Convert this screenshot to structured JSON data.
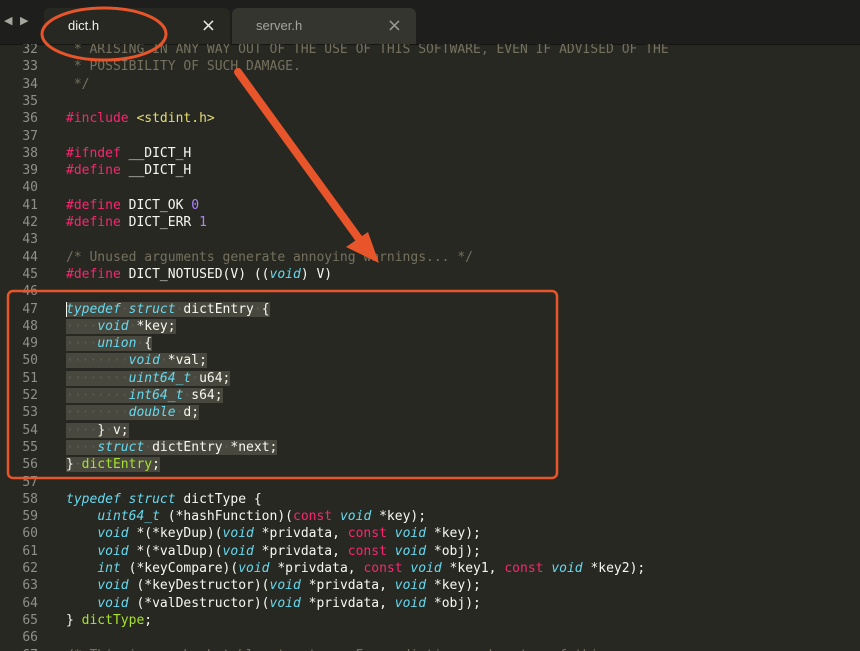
{
  "tabs": [
    {
      "label": "dict.h",
      "active": true
    },
    {
      "label": "server.h",
      "active": false
    }
  ],
  "tab_close_glyph": "×",
  "nav_arrows": "◀ ▶",
  "colors": {
    "comment": "#75715e",
    "keyword": "#f92672",
    "storage": "#66d9ef",
    "string": "#e6db74",
    "number": "#ae81ff",
    "entity": "#a6e22e",
    "annotation": "#e8552a",
    "selection": "#49483e"
  },
  "annotations": {
    "circle_target": "dict.h tab",
    "arrow_target": "dictEntry struct",
    "box_target": "lines 47-56"
  },
  "lines": [
    {
      "n": "32",
      "tokens": [
        [
          "comment",
          " * ARISING IN ANY WAY OUT OF THE USE OF THIS SOFTWARE, EVEN IF ADVISED OF THE"
        ]
      ]
    },
    {
      "n": "33",
      "tokens": [
        [
          "comment",
          " * POSSIBILITY OF SUCH DAMAGE."
        ]
      ]
    },
    {
      "n": "34",
      "tokens": [
        [
          "comment",
          " */"
        ]
      ]
    },
    {
      "n": "35",
      "tokens": []
    },
    {
      "n": "36",
      "tokens": [
        [
          "keyword",
          "#include"
        ],
        [
          "plain",
          " "
        ],
        [
          "string",
          "<stdint.h>"
        ]
      ]
    },
    {
      "n": "37",
      "tokens": []
    },
    {
      "n": "38",
      "tokens": [
        [
          "keyword",
          "#ifndef"
        ],
        [
          "plain",
          " __DICT_H"
        ]
      ]
    },
    {
      "n": "39",
      "tokens": [
        [
          "keyword",
          "#define"
        ],
        [
          "plain",
          " __DICT_H"
        ]
      ]
    },
    {
      "n": "40",
      "tokens": []
    },
    {
      "n": "41",
      "tokens": [
        [
          "keyword",
          "#define"
        ],
        [
          "plain",
          " DICT_OK "
        ],
        [
          "number",
          "0"
        ]
      ]
    },
    {
      "n": "42",
      "tokens": [
        [
          "keyword",
          "#define"
        ],
        [
          "plain",
          " DICT_ERR "
        ],
        [
          "number",
          "1"
        ]
      ]
    },
    {
      "n": "43",
      "tokens": []
    },
    {
      "n": "44",
      "tokens": [
        [
          "comment",
          "/* Unused arguments generate annoying warnings... */"
        ]
      ]
    },
    {
      "n": "45",
      "tokens": [
        [
          "keyword",
          "#define"
        ],
        [
          "plain",
          " DICT_NOTUSED(V) (("
        ],
        [
          "storage",
          "void"
        ],
        [
          "plain",
          ") V)"
        ]
      ]
    },
    {
      "n": "46",
      "tokens": []
    },
    {
      "n": "47",
      "caret": true,
      "tokens": [
        [
          "storage",
          "typedef"
        ],
        [
          "ws",
          "·"
        ],
        [
          "storage",
          "struct"
        ],
        [
          "ws",
          "·"
        ],
        [
          "plain",
          "dictEntry"
        ],
        [
          "ws",
          "·"
        ],
        [
          "plain",
          "{"
        ]
      ],
      "selected": true
    },
    {
      "n": "48",
      "tokens": [
        [
          "ws",
          "····"
        ],
        [
          "storage",
          "void"
        ],
        [
          "ws",
          "·"
        ],
        [
          "plain",
          "*key;"
        ]
      ],
      "selected": true
    },
    {
      "n": "49",
      "tokens": [
        [
          "ws",
          "····"
        ],
        [
          "storage",
          "union"
        ],
        [
          "ws",
          "·"
        ],
        [
          "plain",
          "{"
        ]
      ],
      "selected": true
    },
    {
      "n": "50",
      "tokens": [
        [
          "ws",
          "········"
        ],
        [
          "storage",
          "void"
        ],
        [
          "ws",
          "·"
        ],
        [
          "plain",
          "*val;"
        ]
      ],
      "selected": true
    },
    {
      "n": "51",
      "tokens": [
        [
          "ws",
          "········"
        ],
        [
          "storage",
          "uint64_t"
        ],
        [
          "ws",
          "·"
        ],
        [
          "plain",
          "u64;"
        ]
      ],
      "selected": true
    },
    {
      "n": "52",
      "tokens": [
        [
          "ws",
          "········"
        ],
        [
          "storage",
          "int64_t"
        ],
        [
          "ws",
          "·"
        ],
        [
          "plain",
          "s64;"
        ]
      ],
      "selected": true
    },
    {
      "n": "53",
      "tokens": [
        [
          "ws",
          "········"
        ],
        [
          "storage",
          "double"
        ],
        [
          "ws",
          "·"
        ],
        [
          "plain",
          "d;"
        ]
      ],
      "selected": true
    },
    {
      "n": "54",
      "tokens": [
        [
          "ws",
          "····"
        ],
        [
          "plain",
          "}"
        ],
        [
          "ws",
          "·"
        ],
        [
          "plain",
          "v;"
        ]
      ],
      "selected": true
    },
    {
      "n": "55",
      "tokens": [
        [
          "ws",
          "····"
        ],
        [
          "storage",
          "struct"
        ],
        [
          "ws",
          "·"
        ],
        [
          "plain",
          "dictEntry"
        ],
        [
          "ws",
          "·"
        ],
        [
          "plain",
          "*next;"
        ]
      ],
      "selected": true
    },
    {
      "n": "56",
      "tokens": [
        [
          "plain",
          "}"
        ],
        [
          "ws",
          "·"
        ],
        [
          "entity",
          "dictEntry"
        ],
        [
          "plain",
          ";"
        ]
      ],
      "selected": true
    },
    {
      "n": "57",
      "tokens": []
    },
    {
      "n": "58",
      "tokens": [
        [
          "storage",
          "typedef"
        ],
        [
          "plain",
          " "
        ],
        [
          "storage",
          "struct"
        ],
        [
          "plain",
          " dictType {"
        ]
      ]
    },
    {
      "n": "59",
      "tokens": [
        [
          "plain",
          "    "
        ],
        [
          "storage",
          "uint64_t"
        ],
        [
          "plain",
          " (*hashFunction)("
        ],
        [
          "keyword",
          "const"
        ],
        [
          "plain",
          " "
        ],
        [
          "storage",
          "void"
        ],
        [
          "plain",
          " *key);"
        ]
      ]
    },
    {
      "n": "60",
      "tokens": [
        [
          "plain",
          "    "
        ],
        [
          "storage",
          "void"
        ],
        [
          "plain",
          " *(*keyDup)("
        ],
        [
          "storage",
          "void"
        ],
        [
          "plain",
          " *privdata, "
        ],
        [
          "keyword",
          "const"
        ],
        [
          "plain",
          " "
        ],
        [
          "storage",
          "void"
        ],
        [
          "plain",
          " *key);"
        ]
      ]
    },
    {
      "n": "61",
      "tokens": [
        [
          "plain",
          "    "
        ],
        [
          "storage",
          "void"
        ],
        [
          "plain",
          " *(*valDup)("
        ],
        [
          "storage",
          "void"
        ],
        [
          "plain",
          " *privdata, "
        ],
        [
          "keyword",
          "const"
        ],
        [
          "plain",
          " "
        ],
        [
          "storage",
          "void"
        ],
        [
          "plain",
          " *obj);"
        ]
      ]
    },
    {
      "n": "62",
      "tokens": [
        [
          "plain",
          "    "
        ],
        [
          "storage",
          "int"
        ],
        [
          "plain",
          " (*keyCompare)("
        ],
        [
          "storage",
          "void"
        ],
        [
          "plain",
          " *privdata, "
        ],
        [
          "keyword",
          "const"
        ],
        [
          "plain",
          " "
        ],
        [
          "storage",
          "void"
        ],
        [
          "plain",
          " *key1, "
        ],
        [
          "keyword",
          "const"
        ],
        [
          "plain",
          " "
        ],
        [
          "storage",
          "void"
        ],
        [
          "plain",
          " *key2);"
        ]
      ]
    },
    {
      "n": "63",
      "tokens": [
        [
          "plain",
          "    "
        ],
        [
          "storage",
          "void"
        ],
        [
          "plain",
          " (*keyDestructor)("
        ],
        [
          "storage",
          "void"
        ],
        [
          "plain",
          " *privdata, "
        ],
        [
          "storage",
          "void"
        ],
        [
          "plain",
          " *key);"
        ]
      ]
    },
    {
      "n": "64",
      "tokens": [
        [
          "plain",
          "    "
        ],
        [
          "storage",
          "void"
        ],
        [
          "plain",
          " (*valDestructor)("
        ],
        [
          "storage",
          "void"
        ],
        [
          "plain",
          " *privdata, "
        ],
        [
          "storage",
          "void"
        ],
        [
          "plain",
          " *obj);"
        ]
      ]
    },
    {
      "n": "65",
      "tokens": [
        [
          "plain",
          "} "
        ],
        [
          "entity",
          "dictType"
        ],
        [
          "plain",
          ";"
        ]
      ]
    },
    {
      "n": "66",
      "tokens": []
    },
    {
      "n": "67",
      "tokens": [
        [
          "comment",
          "/* This is our hash table structure. Every dictionary has two of this as we"
        ]
      ]
    }
  ]
}
